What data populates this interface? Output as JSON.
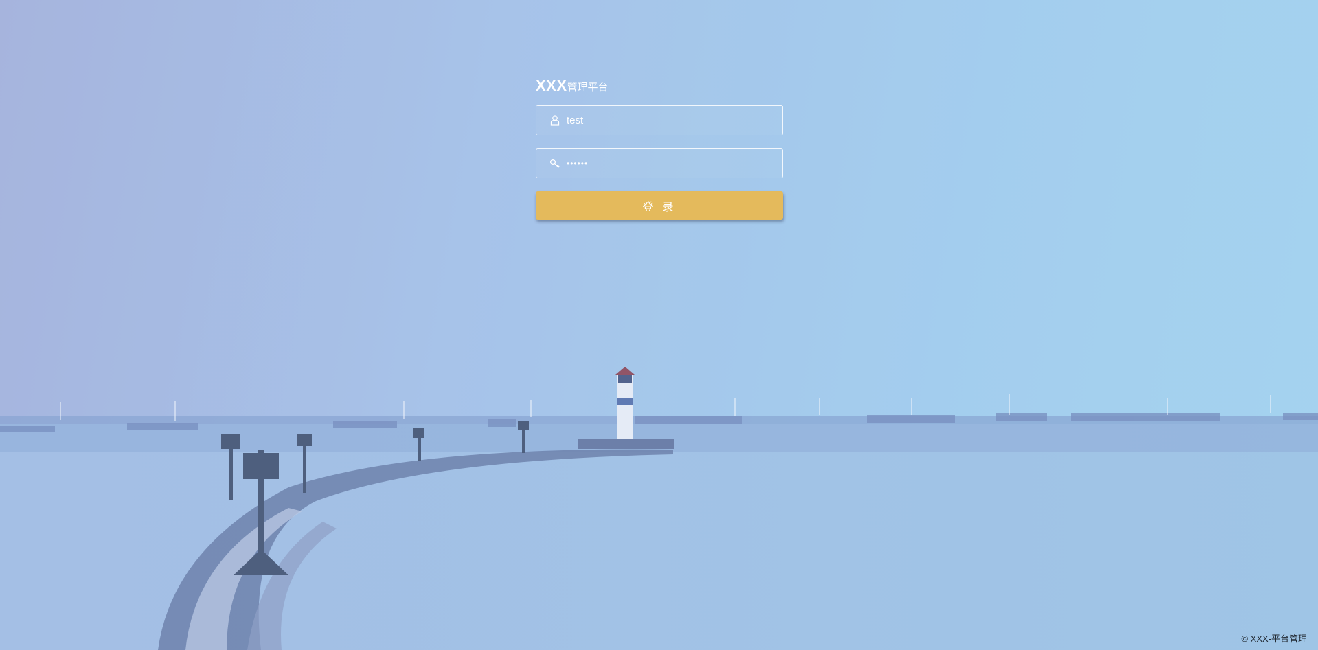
{
  "brand": {
    "name": "XXX",
    "suffix": "管理平台"
  },
  "username_field": {
    "value": "test",
    "icon": "user-icon"
  },
  "password_field": {
    "value": "••••••",
    "icon": "key-icon"
  },
  "login_button": {
    "label": "登 录"
  },
  "footer": {
    "copyright": "© XXX-平台管理"
  },
  "colors": {
    "button": "#e4ba5c",
    "text": "#ffffff",
    "sky_left": "#a4b0da",
    "sky_right": "#a3d6ef",
    "water": "#9ebde0"
  }
}
